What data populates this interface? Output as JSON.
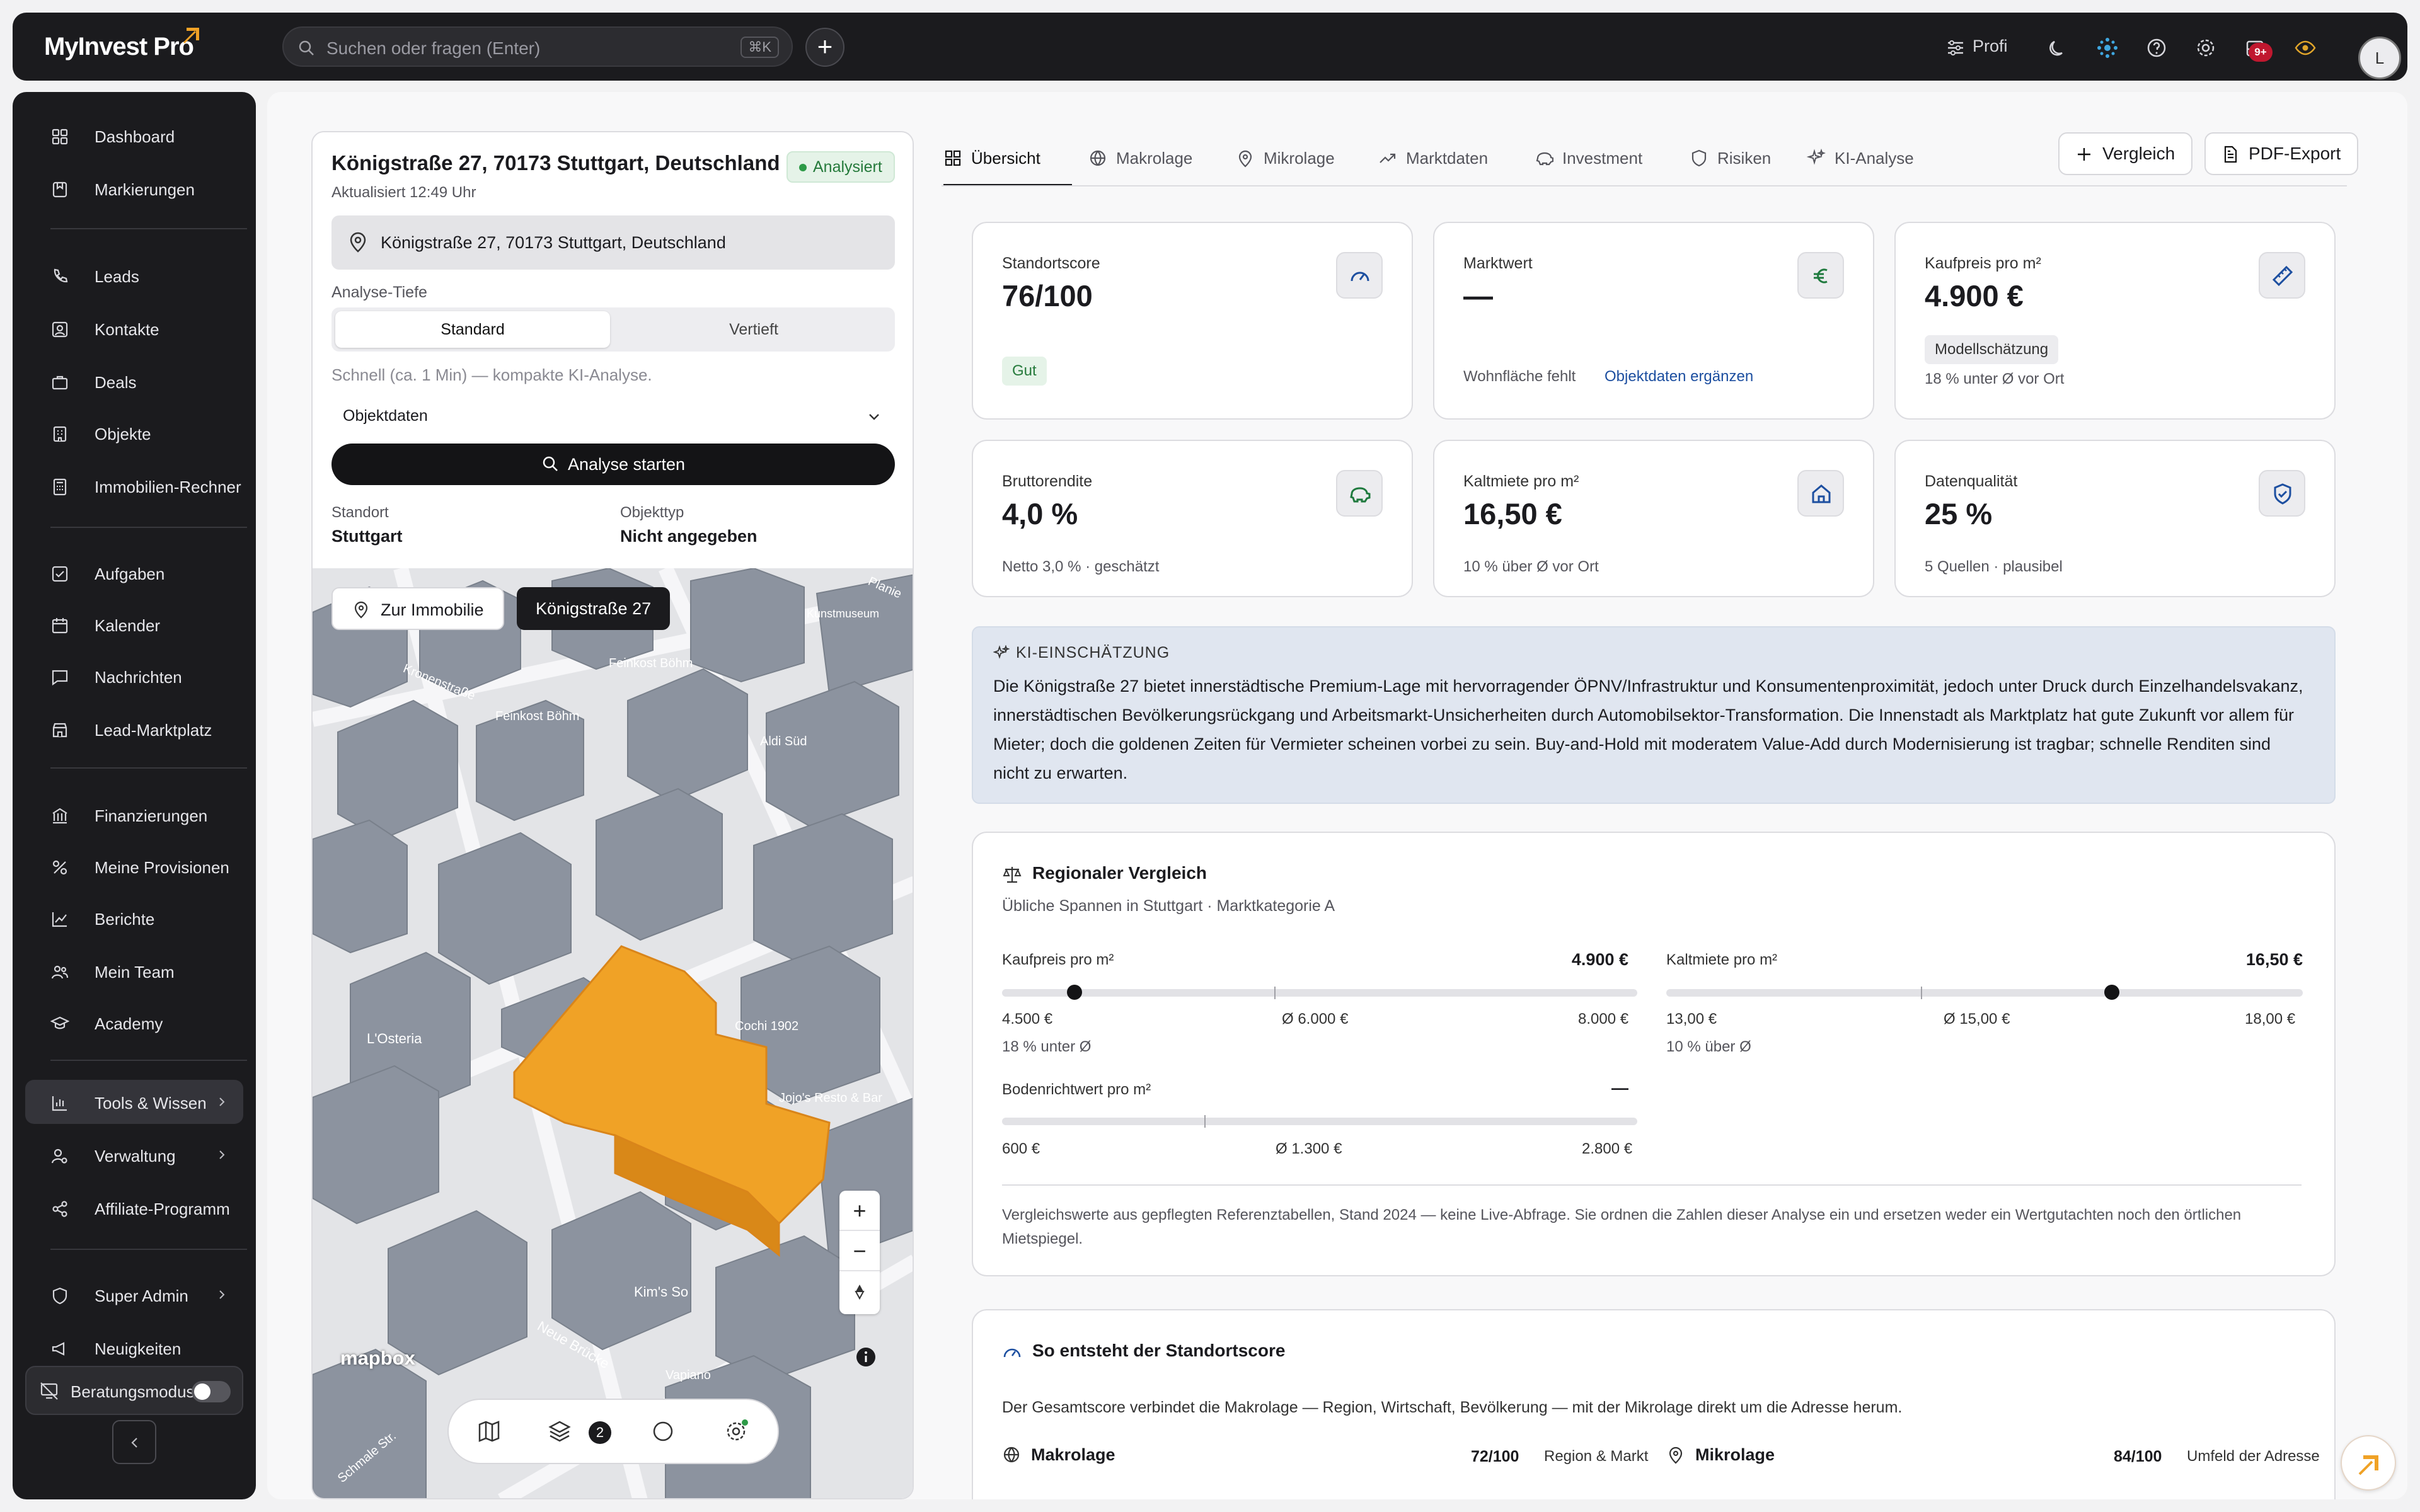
{
  "app": {
    "logo": "MyInvest Pro"
  },
  "topbar": {
    "search_placeholder": "Suchen oder fragen (Enter)",
    "search_shortcut": "⌘K",
    "add_label": "+",
    "profile_mode": "Profi",
    "notification_badge": "9+",
    "avatar_initial": "L"
  },
  "sidebar": {
    "items": [
      {
        "label": "Dashboard",
        "icon": "grid-icon"
      },
      {
        "label": "Markierungen",
        "icon": "bookmark-icon"
      },
      {
        "label": "Leads",
        "icon": "phone-icon"
      },
      {
        "label": "Kontakte",
        "icon": "contact-icon"
      },
      {
        "label": "Deals",
        "icon": "briefcase-icon"
      },
      {
        "label": "Objekte",
        "icon": "building-icon"
      },
      {
        "label": "Immobilien-Rechner",
        "icon": "calculator-icon"
      },
      {
        "label": "Aufgaben",
        "icon": "checkbox-icon"
      },
      {
        "label": "Kalender",
        "icon": "calendar-icon"
      },
      {
        "label": "Nachrichten",
        "icon": "message-icon"
      },
      {
        "label": "Lead-Marktplatz",
        "icon": "store-icon"
      },
      {
        "label": "Finanzierungen",
        "icon": "bank-icon"
      },
      {
        "label": "Meine Provisionen",
        "icon": "percent-icon"
      },
      {
        "label": "Berichte",
        "icon": "chart-icon"
      },
      {
        "label": "Mein Team",
        "icon": "team-icon"
      },
      {
        "label": "Academy",
        "icon": "graduation-icon"
      },
      {
        "label": "Tools & Wissen",
        "icon": "bar-chart-icon"
      },
      {
        "label": "Verwaltung",
        "icon": "user-cog-icon"
      },
      {
        "label": "Affiliate-Programm",
        "icon": "share-icon"
      },
      {
        "label": "Super Admin",
        "icon": "shield-icon"
      },
      {
        "label": "Neuigkeiten",
        "icon": "megaphone-icon"
      }
    ],
    "advisory_mode_label": "Beratungsmodus",
    "advisory_mode_on": false
  },
  "analysis": {
    "address_title": "Königstraße 27, 70173 Stuttgart, Deutschland",
    "status": "Analysiert",
    "updated": "Aktualisiert 12:49 Uhr",
    "address_value": "Königstraße 27, 70173 Stuttgart, Deutschland",
    "depth_label": "Analyse-Tiefe",
    "depth_options": [
      "Standard",
      "Vertieft"
    ],
    "depth_selected": "Standard",
    "depth_hint": "Schnell (ca. 1 Min) — kompakte KI-Analyse.",
    "object_data_label": "Objektdaten",
    "start_button": "Analyse starten",
    "location_label": "Standort",
    "location_value": "Stuttgart",
    "object_type_label": "Objekttyp",
    "object_type_value": "Nicht angegeben"
  },
  "map": {
    "btn_to_property": "Zur Immobilie",
    "btn_address": "Königstraße 27",
    "attribution": "mapbox",
    "layers_count": "2",
    "zoom_in": "+",
    "zoom_out": "−",
    "labels": [
      "Kronenstraße",
      "Feinkost Böhm",
      "Feinkost Böhm",
      "Aldi Süd",
      "Kunstmuseum",
      "Planie",
      "L'Osteria",
      "Cochi 1902",
      "Jojo's Resto & Bar",
      "Kim's So",
      "Neue Brücke",
      "Vapiano",
      "Schmale Str."
    ]
  },
  "tabs": [
    {
      "label": "Übersicht",
      "icon": "grid-icon",
      "active": true
    },
    {
      "label": "Makrolage",
      "icon": "globe-icon"
    },
    {
      "label": "Mikrolage",
      "icon": "pin-icon"
    },
    {
      "label": "Marktdaten",
      "icon": "trend-icon"
    },
    {
      "label": "Investment",
      "icon": "piggy-icon"
    },
    {
      "label": "Risiken",
      "icon": "shield-icon"
    },
    {
      "label": "KI-Analyse",
      "icon": "sparkle-icon"
    }
  ],
  "actions": {
    "compare": "Vergleich",
    "pdf": "PDF-Export"
  },
  "kpis": [
    {
      "title": "Standortscore",
      "value": "76/100",
      "badge": "Gut",
      "icon": "gauge-icon"
    },
    {
      "title": "Marktwert",
      "value": "—",
      "note": "Wohnfläche fehlt",
      "link": "Objektdaten ergänzen",
      "icon": "euro-icon"
    },
    {
      "title": "Kaufpreis pro m²",
      "value": "4.900 €",
      "badge": "Modellschätzung",
      "note": "18 % unter Ø vor Ort",
      "icon": "ruler-icon"
    },
    {
      "title": "Bruttorendite",
      "value": "4,0 %",
      "note": "Netto 3,0 % · geschätzt",
      "icon": "piggy-icon"
    },
    {
      "title": "Kaltmiete pro m²",
      "value": "16,50 €",
      "note": "10 % über Ø vor Ort",
      "icon": "home-icon"
    },
    {
      "title": "Datenqualität",
      "value": "25 %",
      "note": "5 Quellen · plausibel",
      "icon": "shield-check-icon"
    }
  ],
  "ki": {
    "heading": "KI-EINSCHÄTZUNG",
    "text": "Die Königstraße 27 bietet innerstädtische Premium-Lage mit hervorragender ÖPNV/Infrastruktur und Konsumentenproximität, jedoch unter Druck durch Einzelhandelsvakanz, innerstädtischen Bevölkerungsrückgang und Arbeitsmarkt-Unsicherheiten durch Automobilsektor-Transformation. Die Innenstadt als Marktplatz hat gute Zukunft vor allem für Mieter; doch die goldenen Zeiten für Vermieter scheinen vorbei zu sein. Buy-and-Hold mit moderatem Value-Add durch Modernisierung ist tragbar; schnelle Renditen sind nicht zu erwarten."
  },
  "regional": {
    "title": "Regionaler Vergleich",
    "subtitle": "Übliche Spannen in Stuttgart · Marktkategorie A",
    "rows": [
      {
        "label": "Kaufpreis pro m²",
        "value": "4.900 €",
        "min": "4.500 €",
        "avg": "Ø 6.000 €",
        "max": "8.000 €",
        "note": "18 % unter Ø",
        "min_num": 4500,
        "avg_num": 6000,
        "max_num": 8000,
        "val_num": 4900
      },
      {
        "label": "Kaltmiete pro m²",
        "value": "16,50 €",
        "min": "13,00 €",
        "avg": "Ø 15,00 €",
        "max": "18,00 €",
        "note": "10 % über Ø",
        "min_num": 13,
        "avg_num": 15,
        "max_num": 18,
        "val_num": 16.5
      },
      {
        "label": "Bodenrichtwert pro m²",
        "value": "—",
        "min": "600 €",
        "avg": "Ø 1.300 €",
        "max": "2.800 €",
        "note": "",
        "min_num": 600,
        "avg_num": 1300,
        "max_num": 2800,
        "val_num": null
      }
    ],
    "footnote": "Vergleichswerte aus gepflegten Referenztabellen, Stand 2024 — keine Live-Abfrage. Sie ordnen die Zahlen dieser Analyse ein und ersetzen weder ein Wertgutachten noch den örtlichen Mietspiegel."
  },
  "score": {
    "title": "So entsteht der Standortscore",
    "subtitle": "Der Gesamtscore verbindet die Makrolage — Region, Wirtschaft, Bevölkerung — mit der Mikrolage direkt um die Adresse herum.",
    "macro_label": "Makrolage",
    "macro_score": "72/100",
    "macro_sub": "Region & Markt",
    "micro_label": "Mikrolage",
    "micro_score": "84/100",
    "micro_sub": "Umfeld der Adresse"
  },
  "colors": {
    "accent": "#f0a226",
    "dark": "#1b1b1e",
    "ki_bg": "#e0e6f0",
    "success": "#257a3b",
    "link": "#1d4fa0"
  }
}
